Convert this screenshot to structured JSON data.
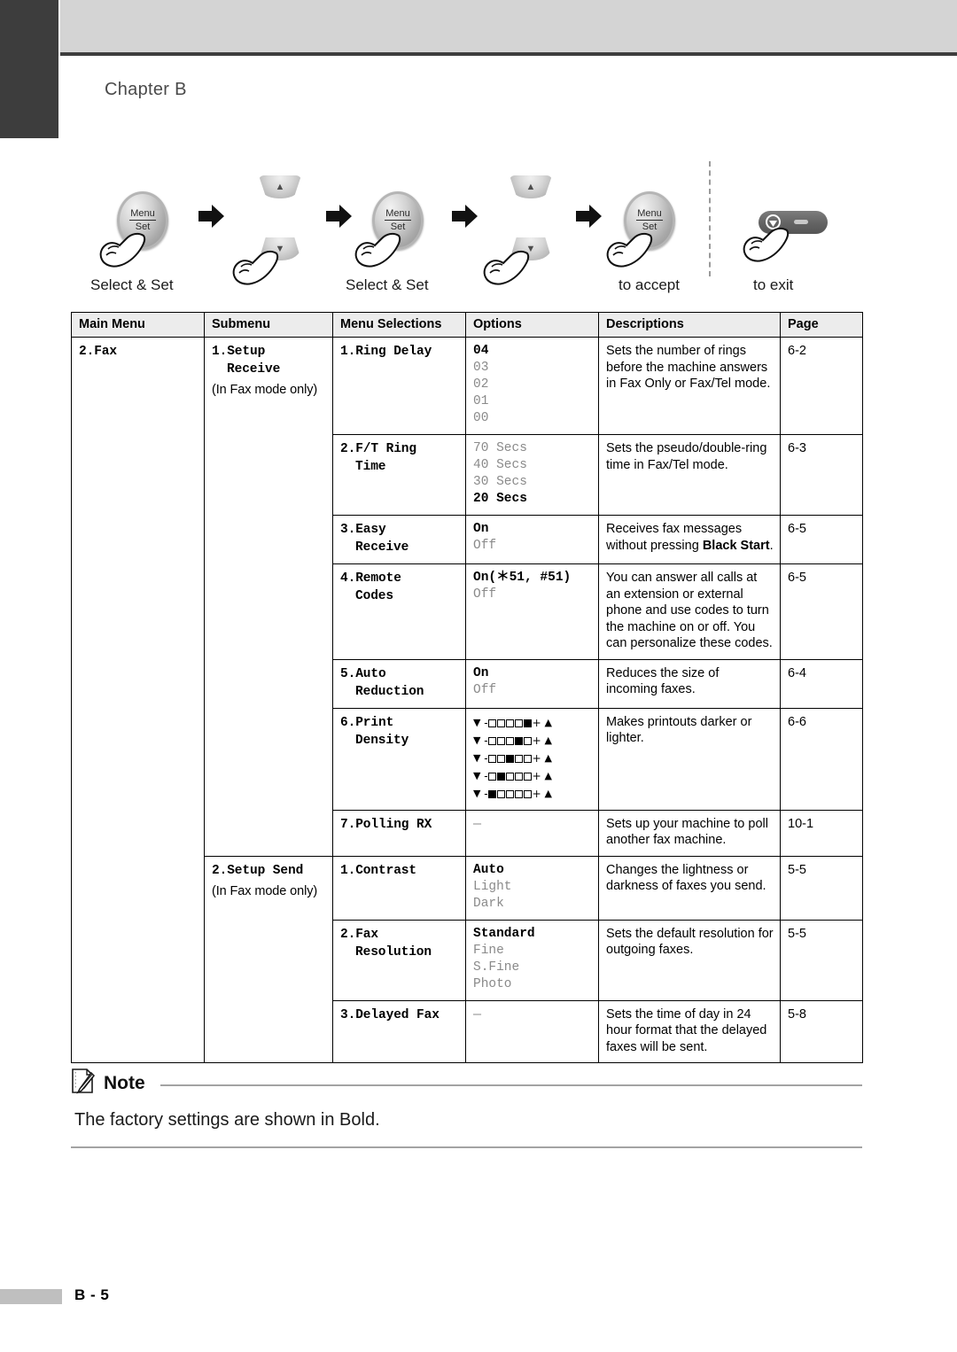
{
  "header": {
    "chapter_label": "Chapter B"
  },
  "footer": {
    "page_number": "B - 5"
  },
  "flow": {
    "buttons": {
      "menu_top": "Menu",
      "menu_bottom": "Set",
      "up_arrow": "▲",
      "down_arrow": "▼"
    },
    "captions": [
      {
        "text": "Select & Set"
      },
      {
        "text": "Select & Set"
      },
      {
        "text": "to accept"
      },
      {
        "text": "to exit"
      }
    ]
  },
  "table": {
    "headers": [
      "Main Menu",
      "Submenu",
      "Menu Selections",
      "Options",
      "Descriptions",
      "Page"
    ],
    "main_menu": {
      "label": "2.Fax"
    },
    "submenus": [
      {
        "line1": "1.Setup",
        "line2": "Receive",
        "paren": "(In Fax mode only)",
        "rows": [
          {
            "selection_line1": "1.Ring Delay",
            "selection_line2": "",
            "options": [
              {
                "text": "04",
                "bold": true
              },
              {
                "text": "03",
                "bold": false
              },
              {
                "text": "02",
                "bold": false
              },
              {
                "text": "01",
                "bold": false
              },
              {
                "text": "00",
                "bold": false
              }
            ],
            "description": "Sets the number of rings before the machine answers in Fax Only or Fax/Tel mode.",
            "description_bold": "",
            "page": "6-2"
          },
          {
            "selection_line1": "2.F/T Ring",
            "selection_line2": "Time",
            "options": [
              {
                "text": "70 Secs",
                "bold": false
              },
              {
                "text": "40 Secs",
                "bold": false
              },
              {
                "text": "30 Secs",
                "bold": false
              },
              {
                "text": "20 Secs",
                "bold": true
              }
            ],
            "description": "Sets the pseudo/double-ring time in Fax/Tel mode.",
            "description_bold": "",
            "page": "6-3"
          },
          {
            "selection_line1": "3.Easy",
            "selection_line2": "Receive",
            "options": [
              {
                "text": "On",
                "bold": true
              },
              {
                "text": "Off",
                "bold": false
              }
            ],
            "description": "Receives fax messages without pressing ",
            "description_bold": "Black Start",
            "description_tail": ".",
            "page": "6-5"
          },
          {
            "selection_line1": "4.Remote",
            "selection_line2": "Codes",
            "options": [
              {
                "text": "On(＊51, #51)",
                "bold": true
              },
              {
                "text": "Off",
                "bold": false
              }
            ],
            "description": "You can answer all calls at an extension or external phone and use codes to turn the machine on or off. You can personalize these codes.",
            "description_bold": "",
            "page": "6-5"
          },
          {
            "selection_line1": "5.Auto",
            "selection_line2": "Reduction",
            "options": [
              {
                "text": "On",
                "bold": true
              },
              {
                "text": "Off",
                "bold": false
              }
            ],
            "description": "Reduces the size of incoming faxes.",
            "description_bold": "",
            "page": "6-4"
          },
          {
            "selection_line1": "6.Print",
            "selection_line2": "Density",
            "density_bars": [
              {
                "filled_index": 5,
                "total": 5
              },
              {
                "filled_index": 4,
                "total": 5
              },
              {
                "filled_index": 3,
                "total": 5
              },
              {
                "filled_index": 2,
                "total": 5
              },
              {
                "filled_index": 1,
                "total": 5
              }
            ],
            "description": "Makes printouts darker or lighter.",
            "description_bold": "",
            "page": "6-6"
          },
          {
            "selection_line1": "7.Polling RX",
            "selection_line2": "",
            "options": [
              {
                "text": "—",
                "bold": false,
                "dash": true
              }
            ],
            "description": "Sets up your machine to poll another fax machine.",
            "description_bold": "",
            "page": "10-1"
          }
        ]
      },
      {
        "line1": "2.Setup Send",
        "line2": "",
        "paren": "(In Fax mode only)",
        "rows": [
          {
            "selection_line1": "1.Contrast",
            "selection_line2": "",
            "options": [
              {
                "text": "Auto",
                "bold": true
              },
              {
                "text": "Light",
                "bold": false
              },
              {
                "text": "Dark",
                "bold": false
              }
            ],
            "description": "Changes the lightness or darkness of faxes you send.",
            "description_bold": "",
            "page": "5-5"
          },
          {
            "selection_line1": "2.Fax",
            "selection_line2": "Resolution",
            "options": [
              {
                "text": "Standard",
                "bold": true
              },
              {
                "text": "Fine",
                "bold": false
              },
              {
                "text": "S.Fine",
                "bold": false
              },
              {
                "text": "Photo",
                "bold": false
              }
            ],
            "description": "Sets the default resolution for outgoing faxes.",
            "description_bold": "",
            "page": "5-5"
          },
          {
            "selection_line1": "3.Delayed Fax",
            "selection_line2": "",
            "options": [
              {
                "text": "—",
                "bold": false,
                "dash": true
              }
            ],
            "description": "Sets the time of day in 24 hour format that the delayed faxes will be sent.",
            "description_bold": "",
            "page": "5-8"
          }
        ]
      }
    ]
  },
  "note": {
    "title": "Note",
    "body": "The factory settings are shown in Bold."
  },
  "colors": {
    "header_dark": "#3d3d3d",
    "header_band": "#d4d4d4",
    "table_header_fill": "#ececec",
    "option_grey": "#8a8a8a",
    "rule_grey": "#a3a3a3"
  }
}
